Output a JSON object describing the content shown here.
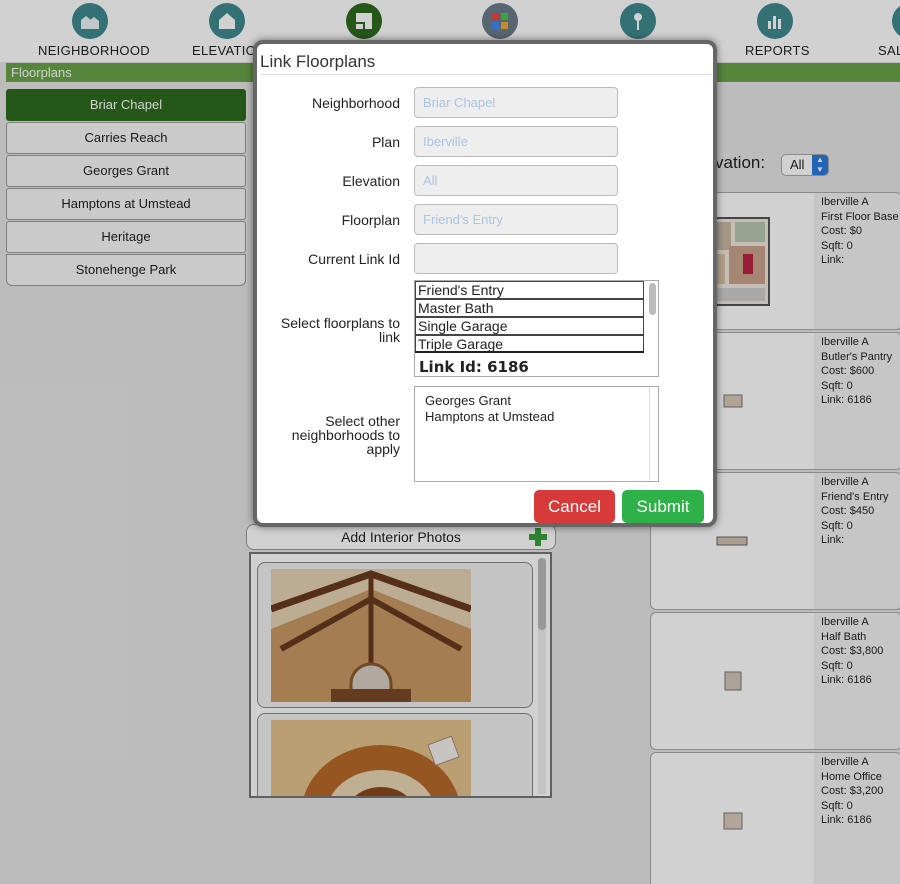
{
  "nav": {
    "items": [
      {
        "label": "NEIGHBORHOOD",
        "icon": "houses-icon"
      },
      {
        "label": "ELEVATIO",
        "icon": "house-icon"
      },
      {
        "label": "",
        "icon": "floorplan-icon"
      },
      {
        "label": "",
        "icon": "options-icon"
      },
      {
        "label": "",
        "icon": "key-icon"
      },
      {
        "label": "REPORTS",
        "icon": "reports-icon"
      },
      {
        "label": "SAL",
        "icon": "sales-icon"
      }
    ]
  },
  "section": {
    "title": "Floorplans"
  },
  "neighborhoods": [
    "Briar Chapel",
    "Carries Reach",
    "Georges Grant",
    "Hamptons at Umstead",
    "Heritage",
    "Stonehenge Park"
  ],
  "interior": {
    "add_label": "Add Interior Photos"
  },
  "elevation_filter": {
    "label": "vation:",
    "value": "All"
  },
  "floorplan_cards": [
    {
      "elevation": "Iberville A",
      "name": "First Floor Base",
      "cost": "Cost:  $0",
      "sqft": "Sqft:  0",
      "link": "Link:"
    },
    {
      "elevation": "Iberville A",
      "name": "Butler's Pantry",
      "cost": "Cost:  $600",
      "sqft": "Sqft:  0",
      "link": "Link: 6186"
    },
    {
      "elevation": "Iberville A",
      "name": "Friend's Entry",
      "cost": "Cost:  $450",
      "sqft": "Sqft:  0",
      "link": "Link:"
    },
    {
      "elevation": "Iberville A",
      "name": "Half Bath",
      "cost": "Cost:  $3,800",
      "sqft": "Sqft:  0",
      "link": "Link: 6186"
    },
    {
      "elevation": "Iberville A",
      "name": "Home Office",
      "cost": "Cost:  $3,200",
      "sqft": "Sqft:  0",
      "link": "Link: 6186"
    }
  ],
  "modal": {
    "title": "Link Floorplans",
    "fields": [
      {
        "label": "Neighborhood",
        "placeholder": "Briar Chapel"
      },
      {
        "label": "Plan",
        "placeholder": "Iberville"
      },
      {
        "label": "Elevation",
        "placeholder": "All"
      },
      {
        "label": "Floorplan",
        "placeholder": "Friend's Entry"
      },
      {
        "label": "Current Link Id",
        "placeholder": ""
      }
    ],
    "select_label": "Select floorplans to link",
    "select_options": [
      "Friend's Entry",
      "Master Bath",
      "Single Garage",
      "Triple Garage"
    ],
    "select_group": "Link Id: 6186",
    "other_label": "Select other neighborhoods to apply",
    "other_options": [
      "Georges Grant",
      "Hamptons at Umstead"
    ],
    "cancel": "Cancel",
    "submit": "Submit"
  }
}
